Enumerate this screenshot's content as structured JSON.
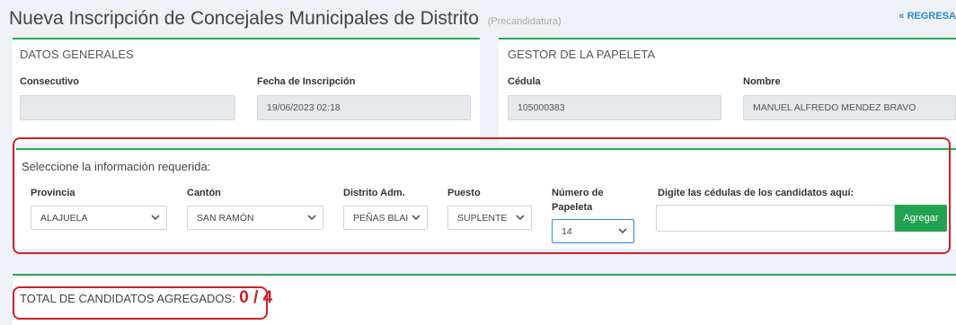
{
  "header": {
    "title": "Nueva Inscripción de Concejales Municipales de Distrito",
    "subtitle": "(Precandidatura)",
    "back_link": "« REGRESA"
  },
  "datos_generales": {
    "heading": "DATOS GENERALES",
    "consecutivo_label": "Consecutivo",
    "consecutivo_value": "",
    "fecha_label": "Fecha de Inscripción",
    "fecha_value": "19/06/2023 02:18"
  },
  "gestor": {
    "heading": "GESTOR DE LA PAPELETA",
    "cedula_label": "Cédula",
    "cedula_value": "105000383",
    "nombre_label": "Nombre",
    "nombre_value": "MANUEL ALFREDO MENDEZ BRAVO"
  },
  "seleccion": {
    "heading": "Seleccione la información requerida:",
    "provincia_label": "Provincia",
    "provincia_value": "ALAJUELA",
    "canton_label": "Cantón",
    "canton_value": "SAN RAMÓN",
    "distrito_label": "Distrito Adm.",
    "distrito_value": "PEÑAS BLAI",
    "puesto_label": "Puesto",
    "puesto_value": "SUPLENTE",
    "numero_label_1": "Número de",
    "numero_label_2": "Papeleta",
    "numero_value": "14",
    "cedulas_label": "Digite las cédulas de los candidatos aquí:",
    "cedulas_value": "",
    "add_button": "Agregar"
  },
  "totales": {
    "label": "TOTAL DE CANDIDATOS AGREGADOS:",
    "value": "0 / 4"
  },
  "colors": {
    "accent_green": "#2ea65a",
    "button_green": "#22a251",
    "highlight_red": "#d11f2a",
    "link_blue": "#2a8bd8"
  }
}
